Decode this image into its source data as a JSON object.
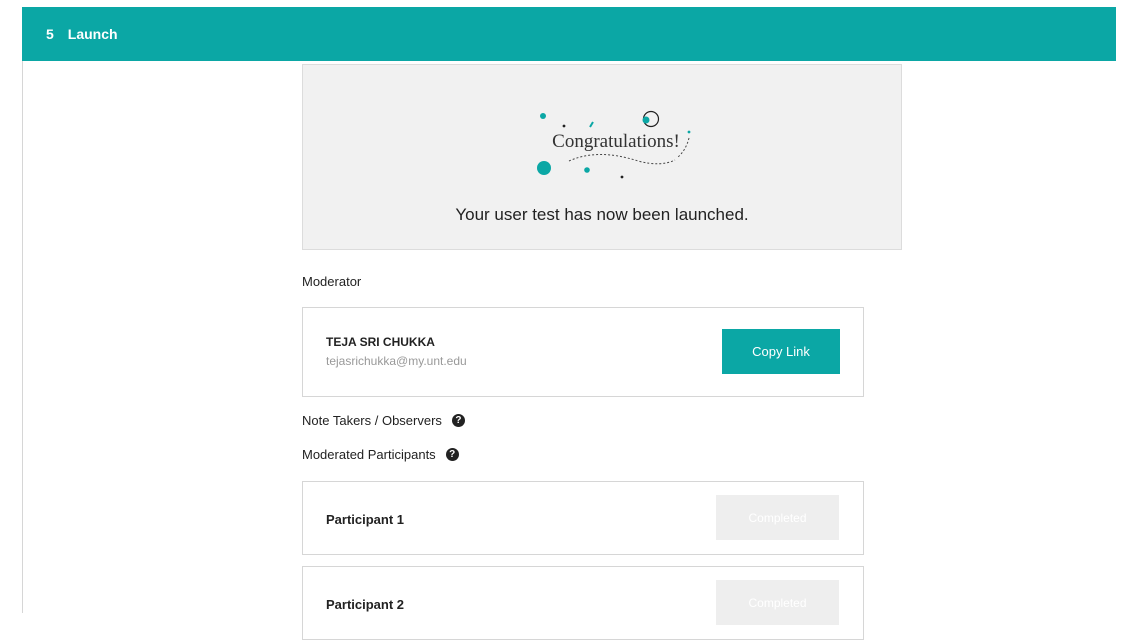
{
  "header": {
    "step_number": "5",
    "step_label": "Launch"
  },
  "congrats": {
    "title": "Congratulations!",
    "message": "Your user test has now been launched."
  },
  "moderator": {
    "section_label": "Moderator",
    "name": "TEJA SRI CHUKKA",
    "email": "tejasrichukka@my.unt.edu",
    "copy_label": "Copy Link"
  },
  "observers": {
    "section_label": "Note Takers / Observers"
  },
  "participants": {
    "section_label": "Moderated Participants",
    "items": [
      {
        "label": "Participant 1",
        "status": "Completed"
      },
      {
        "label": "Participant 2",
        "status": "Completed"
      }
    ]
  },
  "colors": {
    "accent": "#0ba7a5",
    "panel_bg": "#f1f1f1",
    "disabled_bg": "#eeeeee"
  }
}
